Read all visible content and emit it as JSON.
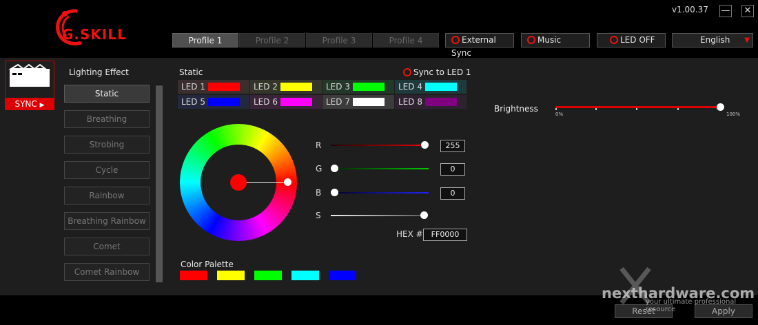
{
  "app": {
    "brand": "G.SKILL",
    "version": "v1.00.37",
    "minimize": "—",
    "close": "✕"
  },
  "profiles": [
    "Profile 1",
    "Profile 2",
    "Profile 3",
    "Profile 4"
  ],
  "topbar": {
    "external_sync": "External Sync",
    "music": "Music",
    "led_off": "LED OFF",
    "language": "English"
  },
  "sync_card": {
    "label": "SYNC"
  },
  "effects": {
    "title": "Lighting Effect",
    "items": [
      "Static",
      "Breathing",
      "Strobing",
      "Cycle",
      "Rainbow",
      "Breathing Rainbow",
      "Comet",
      "Comet Rainbow"
    ],
    "selected": "Static"
  },
  "static_panel": {
    "title": "Static",
    "sync_to_led1": "Sync to LED 1"
  },
  "leds": [
    {
      "label": "LED 1",
      "color": "#ff0000",
      "bg": "#3a2e2e"
    },
    {
      "label": "LED 2",
      "color": "#ffff00",
      "bg": "#34362a"
    },
    {
      "label": "LED 3",
      "color": "#00ff00",
      "bg": "#24382a"
    },
    {
      "label": "LED 4",
      "color": "#00ffff",
      "bg": "#1f3a3c"
    },
    {
      "label": "LED 5",
      "color": "#0000ff",
      "bg": "#24283c"
    },
    {
      "label": "LED 6",
      "color": "#ff00ff",
      "bg": "#3a2438"
    },
    {
      "label": "LED 7",
      "color": "#ffffff",
      "bg": "#3c3c3c"
    },
    {
      "label": "LED 8",
      "color": "#800080",
      "bg": "#2e2230"
    }
  ],
  "rgb": {
    "r_label": "R",
    "g_label": "G",
    "b_label": "B",
    "s_label": "S",
    "r": "255",
    "g": "0",
    "b": "0",
    "hex_label": "HEX #",
    "hex": "FF0000"
  },
  "palette": {
    "title": "Color Palette",
    "colors": [
      "#ff0000",
      "#ffff00",
      "#00ff00",
      "#00ffff",
      "#0000ff"
    ]
  },
  "brightness": {
    "label": "Brightness",
    "min": "0%",
    "max": "100%",
    "value_pct": 100
  },
  "bottom": {
    "reset": "Reset",
    "apply": "Apply"
  },
  "watermark": {
    "site": "nexthardware.com",
    "tagline": "your ultimate professional resource"
  }
}
